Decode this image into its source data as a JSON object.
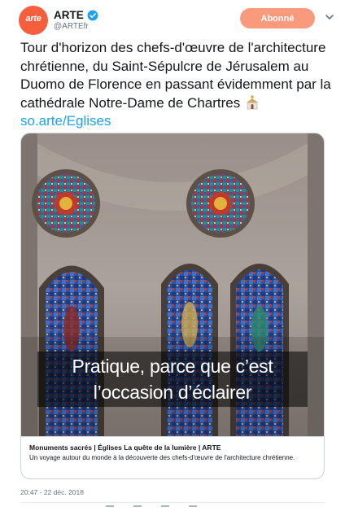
{
  "account": {
    "avatar_text": "arte",
    "name": "ARTE",
    "handle": "@ARTEfr",
    "verified_icon": "verified-badge-icon",
    "follow_label": "Abonné",
    "accent_color": "#f75e3e",
    "follow_color": "#fa9a7c"
  },
  "tweet": {
    "text": "Tour d'horizon des chefs-d'œuvre de l'architecture chrétienne, du Saint-Sépulcre de Jérusalem au Duomo de Florence en passant évidemment par la cathédrale Notre-Dame de Chartres",
    "emoji_icon": "church-icon",
    "link": "so.arte/Eglises",
    "link_color": "#1da1f2"
  },
  "card": {
    "video_subtitle": "Pratique, parce que c’est l’occasion d’éclairer",
    "title": "Monuments sacrés | Églises La quête de la lumière | ARTE",
    "description": "Un voyage autour du monde à la découverte des chefs-d'œuvre de l'architecture chrétienne."
  },
  "timestamp": "20:47 - 22 déc. 2018"
}
